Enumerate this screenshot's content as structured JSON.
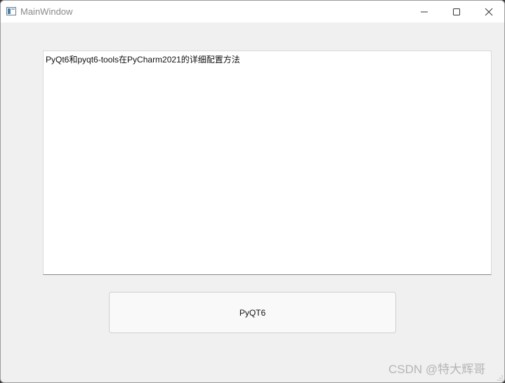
{
  "window": {
    "title": "MainWindow",
    "icons": {
      "app": "window-app-icon",
      "minimize": "minimize-icon",
      "maximize": "maximize-icon",
      "close": "close-icon"
    }
  },
  "main": {
    "text_area_content": "PyQt6和pyqt6-tools在PyCharm2021的详细配置方法",
    "button_label": "PyQT6"
  },
  "watermark": "CSDN @特大辉哥",
  "colors": {
    "background": "#f0f0f0",
    "titlebar": "#ffffff",
    "text_area": "#ffffff",
    "button": "#f9f9f9"
  }
}
